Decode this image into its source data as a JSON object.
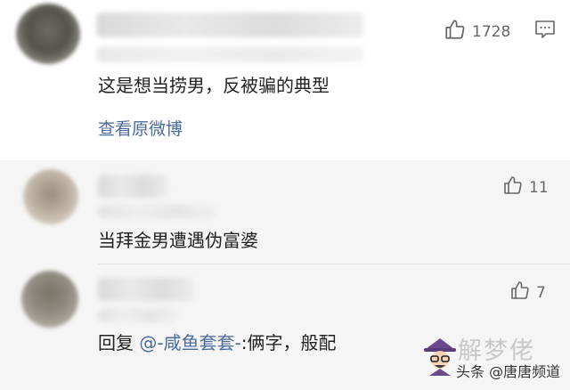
{
  "main_comment": {
    "likes": "1728",
    "text": "这是想当捞男，反被骗的典型",
    "view_original": "查看原微博"
  },
  "replies": [
    {
      "likes": "11",
      "text": "当拜金男遭遇伪富婆"
    },
    {
      "likes": "7",
      "reply_prefix": "回复",
      "mention": "@-咸鱼套套-",
      "reply_rest": ":俩字，般配"
    }
  ],
  "watermark": {
    "logo_text": "解梦佬",
    "credit": "头条 @唐唐频道"
  },
  "colors": {
    "reply_background": "#f5f5f5",
    "link": "#4a6c9b"
  },
  "icons": [
    "thumbs-up-icon",
    "comment-icon"
  ]
}
